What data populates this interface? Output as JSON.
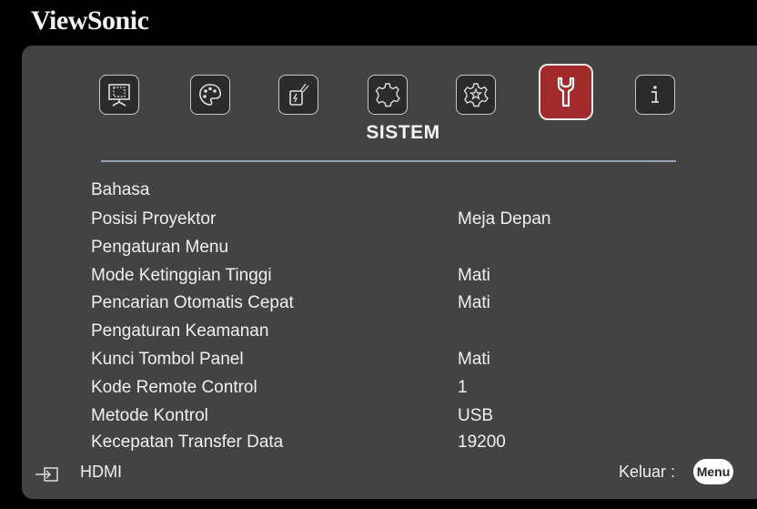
{
  "brand": "ViewSonic",
  "tabs": [
    {
      "icon": "display-icon"
    },
    {
      "icon": "palette-icon"
    },
    {
      "icon": "power-icon"
    },
    {
      "icon": "basic-gear-icon"
    },
    {
      "icon": "advanced-gear-icon"
    },
    {
      "icon": "wrench-icon"
    },
    {
      "icon": "info-icon"
    }
  ],
  "active_tab_title": "SISTEM",
  "menu_items": [
    {
      "label": "Bahasa",
      "value": ""
    },
    {
      "label": "Posisi Proyektor",
      "value": "Meja Depan"
    },
    {
      "label": "Pengaturan Menu",
      "value": ""
    },
    {
      "label": "Mode Ketinggian Tinggi",
      "value": "Mati"
    },
    {
      "label": "Pencarian Otomatis Cepat",
      "value": "Mati"
    },
    {
      "label": "Pengaturan Keamanan",
      "value": ""
    },
    {
      "label": "Kunci Tombol Panel",
      "value": "Mati"
    },
    {
      "label": "Kode Remote Control",
      "value": "1"
    },
    {
      "label": "Metode Kontrol",
      "value": "USB"
    },
    {
      "label": "Kecepatan Transfer Data",
      "value": "19200"
    }
  ],
  "footer": {
    "source": "HDMI",
    "exit_label": "Keluar :",
    "menu_button": "Menu"
  },
  "colors": {
    "panel": "#434343",
    "active_tab": "#a32a2a",
    "divider": "#9aa3b8"
  }
}
